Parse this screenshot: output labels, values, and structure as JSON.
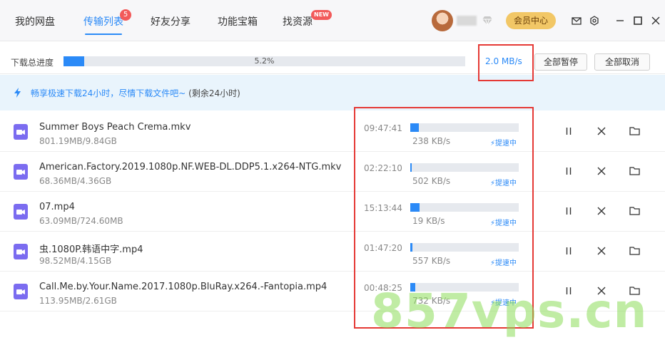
{
  "nav": {
    "tabs": [
      {
        "label": "我的网盘"
      },
      {
        "label": "传输列表"
      },
      {
        "label": "好友分享"
      },
      {
        "label": "功能宝箱"
      },
      {
        "label": "找资源"
      }
    ],
    "transfer_badge": "5",
    "new_badge": "NEW",
    "vip_label": "会员中心"
  },
  "progress": {
    "label": "下载总进度",
    "percent_text": "5.2%",
    "percent": 5.2,
    "speed": "2.0 MB/s",
    "pause_all": "全部暂停",
    "cancel_all": "全部取消"
  },
  "banner": {
    "text": "畅享极速下载24小时，尽情下载文件吧~",
    "remaining": "(剩余24小时)"
  },
  "files": [
    {
      "name": "Summer Boys Peach Crema.mkv",
      "size": "801.19MB/9.84GB",
      "time": "09:47:41",
      "speed": "238 KB/s",
      "progress": 7.9,
      "accel": "提速中"
    },
    {
      "name": "American.Factory.2019.1080p.NF.WEB-DL.DDP5.1.x264-NTG.mkv",
      "size": "68.36MB/4.36GB",
      "time": "02:22:10",
      "speed": "502 KB/s",
      "progress": 1.5,
      "accel": "提速中"
    },
    {
      "name": "07.mp4",
      "size": "63.09MB/724.60MB",
      "time": "15:13:44",
      "speed": "19 KB/s",
      "progress": 8.7,
      "accel": "提速中"
    },
    {
      "name": "虫.1080P.韩语中字.mp4",
      "size": "98.52MB/4.15GB",
      "time": "01:47:20",
      "speed": "557 KB/s",
      "progress": 2.3,
      "accel": "提速中"
    },
    {
      "name": "Call.Me.by.Your.Name.2017.1080p.BluRay.x264.-Fantopia.mp4",
      "size": "113.95MB/2.61GB",
      "time": "00:48:25",
      "speed": "732 KB/s",
      "progress": 4.3,
      "accel": "提速中"
    }
  ],
  "watermark": "857vps.cn",
  "colors": {
    "accent": "#2b8af7",
    "annotation": "#e53935",
    "vip": "#f2c766"
  }
}
